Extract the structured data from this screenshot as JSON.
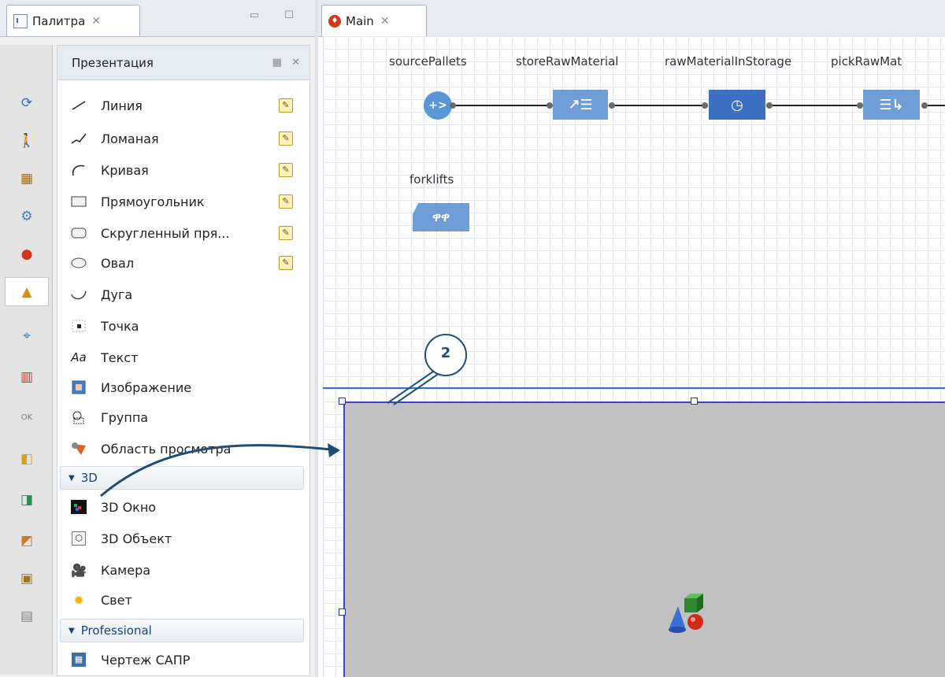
{
  "palette_view": {
    "tab_title": "Палитра",
    "close_glyph": "✕",
    "minimize_glyph": "▭",
    "maximize_glyph": "☐"
  },
  "palette": {
    "section_title": "Презентация",
    "items": [
      {
        "label": "Линия",
        "icon": "line-icon",
        "editable": true
      },
      {
        "label": "Ломаная",
        "icon": "polyline-icon",
        "editable": true
      },
      {
        "label": "Кривая",
        "icon": "curve-icon",
        "editable": true
      },
      {
        "label": "Прямоугольник",
        "icon": "rectangle-icon",
        "editable": true
      },
      {
        "label": "Скругленный пря...",
        "icon": "rounded-rectangle-icon",
        "editable": true
      },
      {
        "label": "Овал",
        "icon": "oval-icon",
        "editable": true
      },
      {
        "label": "Дуга",
        "icon": "arc-icon",
        "editable": false
      },
      {
        "label": "Точка",
        "icon": "point-icon",
        "editable": false
      },
      {
        "label": "Текст",
        "icon": "text-icon",
        "editable": false
      },
      {
        "label": "Изображение",
        "icon": "image-icon",
        "editable": false
      },
      {
        "label": "Группа",
        "icon": "group-icon",
        "editable": false
      },
      {
        "label": "Область просмотра",
        "icon": "view-area-icon",
        "editable": false
      }
    ],
    "group_3d": {
      "title": "3D",
      "items": [
        {
          "label": "3D Окно",
          "icon": "3d-window-icon"
        },
        {
          "label": "3D Объект",
          "icon": "3d-object-icon"
        },
        {
          "label": "Камера",
          "icon": "camera-icon"
        },
        {
          "label": "Свет",
          "icon": "light-icon"
        }
      ]
    },
    "group_professional": {
      "title": "Professional",
      "items": [
        {
          "label": "Чертеж САПР",
          "icon": "cad-drawing-icon"
        }
      ]
    }
  },
  "editor": {
    "tab_title": "Main",
    "close_glyph": "✕",
    "blocks": {
      "source": "sourcePallets",
      "store": "storeRawMaterial",
      "delay": "rawMaterialInStorage",
      "pick": "pickRawMat",
      "resource": "forklifts"
    }
  },
  "callout": {
    "number": "2"
  },
  "colors": {
    "block_blue": "#6f9dd8",
    "block_dark_blue": "#3d6fc3",
    "viewport_gray": "#c1c1c1",
    "selection_blue": "#3a45c8",
    "callout_navy": "#1f4d7a"
  }
}
